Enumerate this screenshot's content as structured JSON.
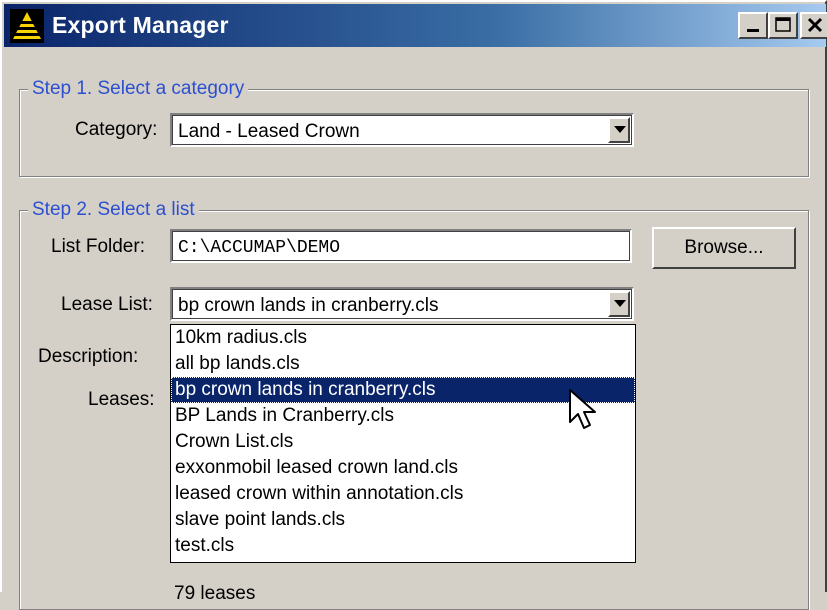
{
  "window": {
    "title": "Export Manager",
    "controls": {
      "minimize": "_",
      "maximize": "□",
      "close": "X"
    }
  },
  "step1": {
    "legend": "Step 1.  Select a category",
    "category_label": "Category:",
    "category_value": "Land - Leased Crown"
  },
  "step2": {
    "legend": "Step 2.  Select a list",
    "folder_label": "List Folder:",
    "folder_value": "C:\\ACCUMAP\\DEMO",
    "browse_label": "Browse...",
    "lease_list_label": "Lease List:",
    "lease_list_value": "bp crown lands in cranberry.cls",
    "description_label": "Description:",
    "leases_label": "Leases:",
    "leases_count": "79 leases",
    "lease_list_options": [
      "10km radius.cls",
      "all bp lands.cls",
      "bp crown lands in cranberry.cls",
      "BP Lands in Cranberry.cls",
      "Crown List.cls",
      "exxonmobil leased crown land.cls",
      "leased crown within annotation.cls",
      "slave point lands.cls",
      "test.cls"
    ],
    "selected_index": 2
  },
  "colors": {
    "title_bar": "#0a246a",
    "legend_text": "#2c4fd1",
    "selection": "#0a246a",
    "face": "#d4d0c8"
  }
}
